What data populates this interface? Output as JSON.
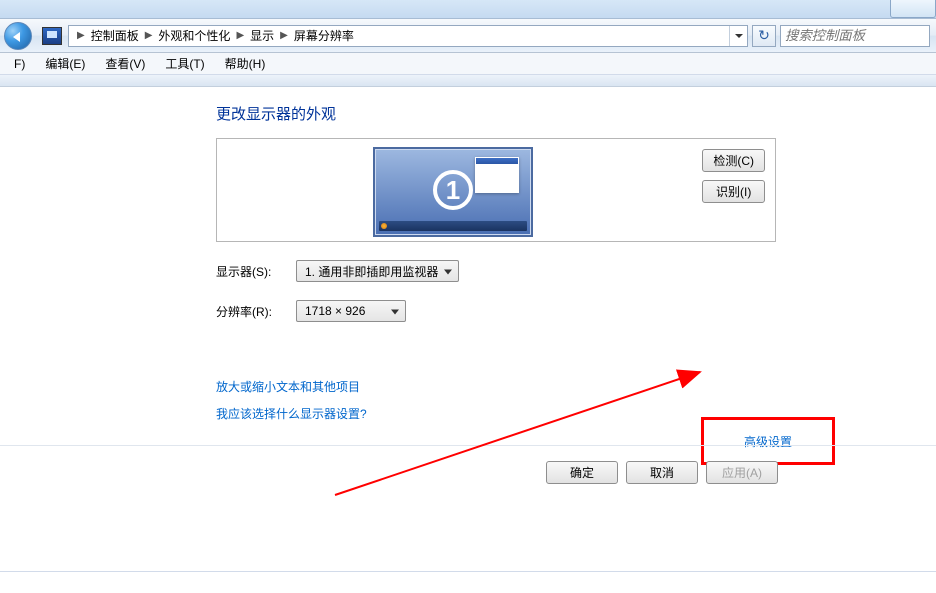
{
  "breadcrumb": {
    "items": [
      "控制面板",
      "外观和个性化",
      "显示",
      "屏幕分辨率"
    ]
  },
  "search": {
    "placeholder": "搜索控制面板"
  },
  "menu": {
    "file": "F)",
    "edit": "编辑(E)",
    "view": "查看(V)",
    "tools": "工具(T)",
    "help": "帮助(H)"
  },
  "heading": "更改显示器的外观",
  "preview": {
    "monitor_number": "1",
    "detect_label": "检测(C)",
    "identify_label": "识别(I)"
  },
  "form": {
    "display_label": "显示器(S):",
    "display_value": "1. 通用非即插即用监视器",
    "resolution_label": "分辨率(R):",
    "resolution_value": "1718 × 926"
  },
  "links": {
    "zoom": "放大或缩小文本和其他项目",
    "help": "我应该选择什么显示器设置?",
    "advanced": "高级设置"
  },
  "buttons": {
    "ok": "确定",
    "cancel": "取消",
    "apply": "应用(A)"
  }
}
